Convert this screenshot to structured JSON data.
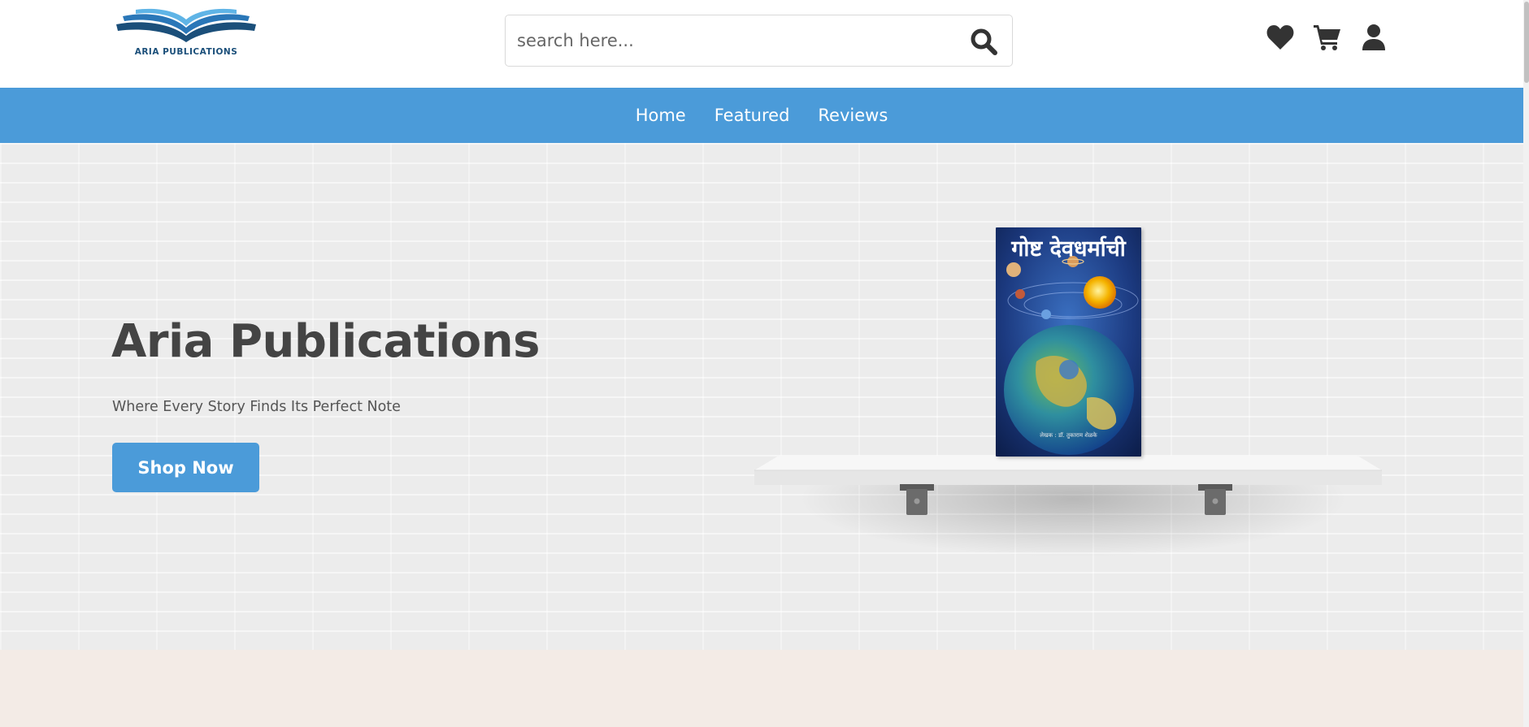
{
  "header": {
    "logo_text": "ARIA PUBLICATIONS",
    "search_placeholder": "search here...",
    "icons": [
      "heart-icon",
      "cart-icon",
      "user-icon"
    ]
  },
  "nav": {
    "items": [
      {
        "label": "Home"
      },
      {
        "label": "Featured"
      },
      {
        "label": "Reviews"
      }
    ]
  },
  "hero": {
    "title": "Aria Publications",
    "subtitle": "Where Every Story Finds Its Perfect Note",
    "cta_label": "Shop Now",
    "book": {
      "title": "गोष्ट देवधर्माची",
      "author": "लेखक : डॉ. तुकाराम शेळके"
    }
  },
  "colors": {
    "accent": "#4b9bd9",
    "title_text": "#444444",
    "hero_bg": "#ececec",
    "bottom_band": "#f3ebe6",
    "logo_blue": "#1b4f7a"
  }
}
